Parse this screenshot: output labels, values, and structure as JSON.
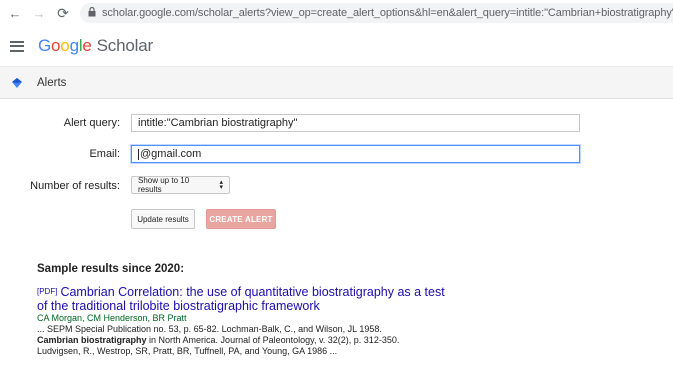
{
  "browser": {
    "back_icon": "←",
    "forward_icon": "→",
    "reload_icon": "⟳",
    "url": "scholar.google.com/scholar_alerts?view_op=create_alert_options&hl=en&alert_query=intitle:\"Cambrian+biostratigraphy\"&alert_params=..."
  },
  "header": {
    "logo_google": [
      "G",
      "o",
      "o",
      "g",
      "l",
      "e"
    ],
    "logo_scholar": "Scholar"
  },
  "alerts_bar": {
    "title": "Alerts"
  },
  "form": {
    "query_label": "Alert query:",
    "query_value": "intitle:\"Cambrian biostratigraphy\"",
    "email_label": "Email:",
    "email_value": "@gmail.com",
    "num_results_label": "Number of results:",
    "num_results_value": "Show up to 10 results",
    "update_button": "Update results",
    "create_button": "CREATE ALERT"
  },
  "results": {
    "heading": "Sample results since 2020:",
    "items": [
      {
        "tag": "[PDF]",
        "title": "Cambrian Correlation: the use of quantitative biostratigraphy as a test of the traditional trilobite biostratigraphic framework",
        "authors": "CA Morgan, CM Henderson, BR Pratt",
        "snippet_1": "... SEPM Special Publication no. 53, p. 65-82. Lochman-Balk, C., and Wilson, JL 1958.",
        "snippet_2_bold": "Cambrian biostratigraphy",
        "snippet_2_rest": " in North America. Journal of Paleontology, v. 32(2), p. 312-350.",
        "snippet_3": "Ludvigsen, R., Westrop, SR, Pratt, BR, Tuffnell, PA, and Young, GA 1986 ..."
      }
    ]
  },
  "colors": {
    "link": "#1a0dab",
    "authors": "#006621",
    "create_button_bg": "#e9a6a1",
    "focus_border": "#4d90fe"
  }
}
